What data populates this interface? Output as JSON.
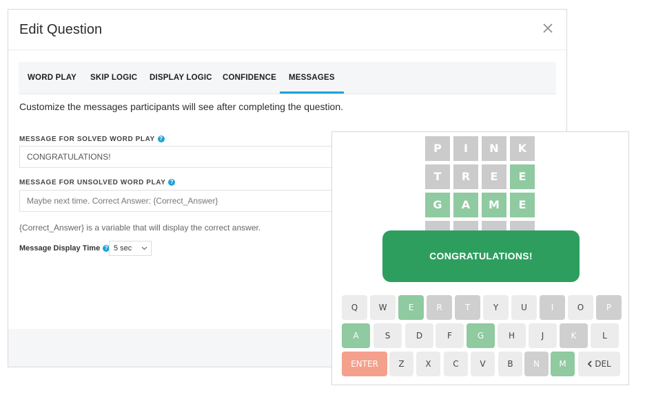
{
  "modal": {
    "title": "Edit Question",
    "close_icon": "close-icon",
    "tabs": [
      {
        "label": "WORD PLAY"
      },
      {
        "label": "SKIP LOGIC"
      },
      {
        "label": "DISPLAY LOGIC"
      },
      {
        "label": "CONFIDENCE"
      },
      {
        "label": "MESSAGES",
        "active": true
      }
    ],
    "intro": "Customize the messages participants will see after completing the question.",
    "solved": {
      "label": "MESSAGE FOR SOLVED WORD PLAY",
      "help": "?",
      "value": "CONGRATULATIONS!"
    },
    "unsolved": {
      "label": "MESSAGE FOR UNSOLVED WORD PLAY",
      "help": "?",
      "placeholder": "Maybe next time. Correct Answer: {Correct_Answer}"
    },
    "hint": "{Correct_Answer} is a variable that will display the correct answer.",
    "display_time": {
      "label": "Message Display Time",
      "help": "?",
      "value": "5 sec"
    }
  },
  "game": {
    "colors": {
      "gray": "#cbcbcb",
      "green": "#8fcaa0",
      "toast": "#2e9e5f",
      "enter": "#f4a08d",
      "key_gray": "#cfcfcf",
      "key_light": "#ececec"
    },
    "rows": [
      [
        {
          "letter": "P",
          "state": "gray"
        },
        {
          "letter": "I",
          "state": "gray"
        },
        {
          "letter": "N",
          "state": "gray"
        },
        {
          "letter": "K",
          "state": "gray"
        }
      ],
      [
        {
          "letter": "T",
          "state": "gray"
        },
        {
          "letter": "R",
          "state": "gray"
        },
        {
          "letter": "E",
          "state": "gray"
        },
        {
          "letter": "E",
          "state": "green"
        }
      ],
      [
        {
          "letter": "G",
          "state": "green"
        },
        {
          "letter": "A",
          "state": "green"
        },
        {
          "letter": "M",
          "state": "green"
        },
        {
          "letter": "E",
          "state": "green"
        }
      ],
      [
        {
          "letter": "",
          "state": "gray"
        },
        {
          "letter": "",
          "state": "gray"
        },
        {
          "letter": "",
          "state": "gray"
        },
        {
          "letter": "",
          "state": "gray"
        }
      ]
    ],
    "toast": "CONGRATULATIONS!",
    "keyboard": [
      [
        {
          "k": "Q",
          "s": "light"
        },
        {
          "k": "W",
          "s": "light"
        },
        {
          "k": "E",
          "s": "green"
        },
        {
          "k": "R",
          "s": "gray"
        },
        {
          "k": "T",
          "s": "gray"
        },
        {
          "k": "Y",
          "s": "light"
        },
        {
          "k": "U",
          "s": "light"
        },
        {
          "k": "I",
          "s": "gray"
        },
        {
          "k": "O",
          "s": "light"
        },
        {
          "k": "P",
          "s": "gray"
        }
      ],
      [
        {
          "k": "A",
          "s": "green"
        },
        {
          "k": "S",
          "s": "light"
        },
        {
          "k": "D",
          "s": "light"
        },
        {
          "k": "F",
          "s": "light"
        },
        {
          "k": "G",
          "s": "green"
        },
        {
          "k": "H",
          "s": "light"
        },
        {
          "k": "J",
          "s": "light"
        },
        {
          "k": "K",
          "s": "gray"
        },
        {
          "k": "L",
          "s": "light"
        }
      ],
      [
        {
          "k": "ENTER",
          "s": "enter"
        },
        {
          "k": "Z",
          "s": "light"
        },
        {
          "k": "X",
          "s": "light"
        },
        {
          "k": "C",
          "s": "light"
        },
        {
          "k": "V",
          "s": "light"
        },
        {
          "k": "B",
          "s": "light"
        },
        {
          "k": "N",
          "s": "gray"
        },
        {
          "k": "M",
          "s": "green"
        },
        {
          "k": "DEL",
          "s": "light",
          "icon": "chevron-left-icon"
        }
      ]
    ]
  }
}
